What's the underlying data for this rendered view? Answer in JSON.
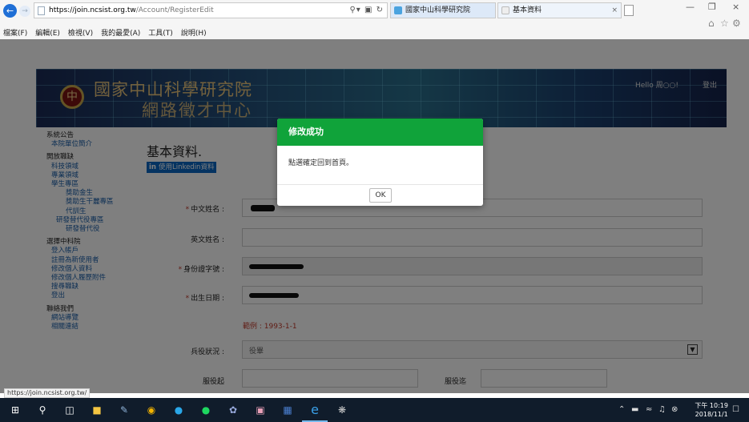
{
  "browser": {
    "url_host": "https://join.ncsist.org.tw",
    "url_path": "/Account/RegisterEdit",
    "tabs": [
      {
        "label": "國家中山科學研究院",
        "active": true
      },
      {
        "label": "基本資料",
        "active": false
      }
    ],
    "menu": [
      "檔案(F)",
      "編輯(E)",
      "檢視(V)",
      "我的最愛(A)",
      "工具(T)",
      "說明(H)"
    ],
    "status_url": "https://join.ncsist.org.tw/"
  },
  "site": {
    "title_line1": "國家中山科學研究院",
    "title_line2": "網路徵才中心",
    "hello": "Hello 周○○!",
    "logout": "登出"
  },
  "sidebar": [
    {
      "text": "系統公告",
      "level": "head"
    },
    {
      "text": "本院單位簡介",
      "level": "l1"
    },
    {
      "text": "開放職缺",
      "level": "head",
      "gap": true
    },
    {
      "text": "科技領域",
      "level": "l1"
    },
    {
      "text": "專業領域",
      "level": "l1"
    },
    {
      "text": "學生專區",
      "level": "l1"
    },
    {
      "text": "獎助金生",
      "level": "l3"
    },
    {
      "text": "獎助生干麗專區",
      "level": "l3"
    },
    {
      "text": "代訓生",
      "level": "l3"
    },
    {
      "text": "研發替代役專區",
      "level": "l2"
    },
    {
      "text": "研發替代役",
      "level": "l3"
    },
    {
      "text": "選擇中科院",
      "level": "head",
      "gap": true
    },
    {
      "text": "登入帳戶",
      "level": "l1"
    },
    {
      "text": "註冊為新使用者",
      "level": "l1"
    },
    {
      "text": "修改個人資料",
      "level": "l1"
    },
    {
      "text": "修改個人履歷附件",
      "level": "l1"
    },
    {
      "text": "搜尋職缺",
      "level": "l1"
    },
    {
      "text": "登出",
      "level": "l1"
    },
    {
      "text": "聯絡我們",
      "level": "head",
      "gap": true
    },
    {
      "text": "網站導覽",
      "level": "l1"
    },
    {
      "text": "相關連結",
      "level": "l1"
    }
  ],
  "main": {
    "title": "基本資料.",
    "linkedin_logo": "in",
    "linkedin_label": "使用Linkedin資料"
  },
  "form": {
    "cn_name_label": "中文姓名 :",
    "en_name_label": "英文姓名 :",
    "id_label": "身份證字號 :",
    "dob_label": "出生日期 :",
    "dob_example": "範例 : 1993-1-1",
    "military_label": "兵役狀況 :",
    "military_value": "役畢",
    "service_start_label": "服役起",
    "service_end_label": "服役迄"
  },
  "modal": {
    "title": "修改成功",
    "message": "點選確定回到首頁。",
    "ok_label": "OK"
  },
  "taskbar": {
    "time": "下午 10:19",
    "date": "2018/11/1"
  },
  "colors": {
    "modal_header": "#10a33a",
    "required_star": "#c0392b",
    "linkedin": "#0a66c2",
    "taskbar": "#101c2b"
  }
}
